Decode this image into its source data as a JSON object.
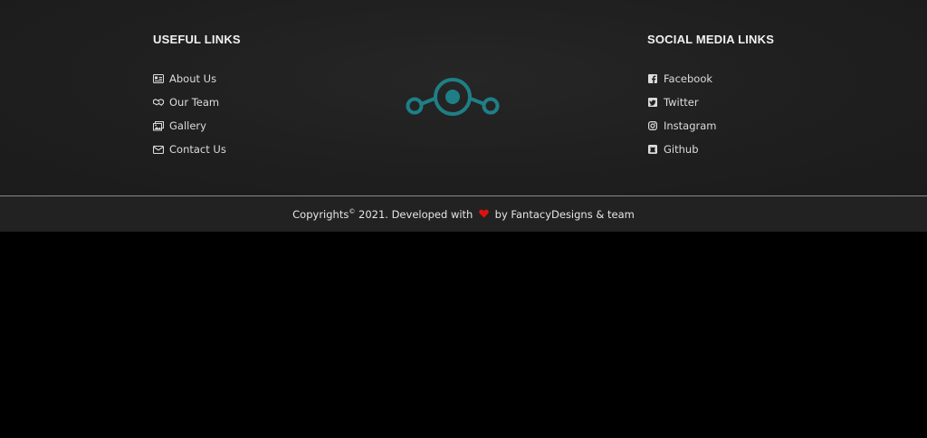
{
  "useful_links": {
    "title": "USEFUL LINKS",
    "items": [
      {
        "label": "About Us",
        "icon": "id-card-icon"
      },
      {
        "label": "Our Team",
        "icon": "handshake-icon"
      },
      {
        "label": "Gallery",
        "icon": "images-icon"
      },
      {
        "label": "Contact Us",
        "icon": "envelope-icon"
      }
    ]
  },
  "social_links": {
    "title": "SOCIAL MEDIA LINKS",
    "items": [
      {
        "label": "Facebook",
        "icon": "facebook-icon"
      },
      {
        "label": "Twitter",
        "icon": "twitter-icon"
      },
      {
        "label": "Instagram",
        "icon": "instagram-icon"
      },
      {
        "label": "Github",
        "icon": "github-icon"
      }
    ]
  },
  "logo": {
    "icon": "lineageos-logo-icon",
    "color": "#1f7f86"
  },
  "copyright": {
    "prefix": "Copyrights",
    "symbol": "©",
    "middle": " 2021. Developed with ",
    "heart_icon": "heart-icon",
    "heart_color": "#e01010",
    "suffix": " by FantacyDesigns & team"
  }
}
